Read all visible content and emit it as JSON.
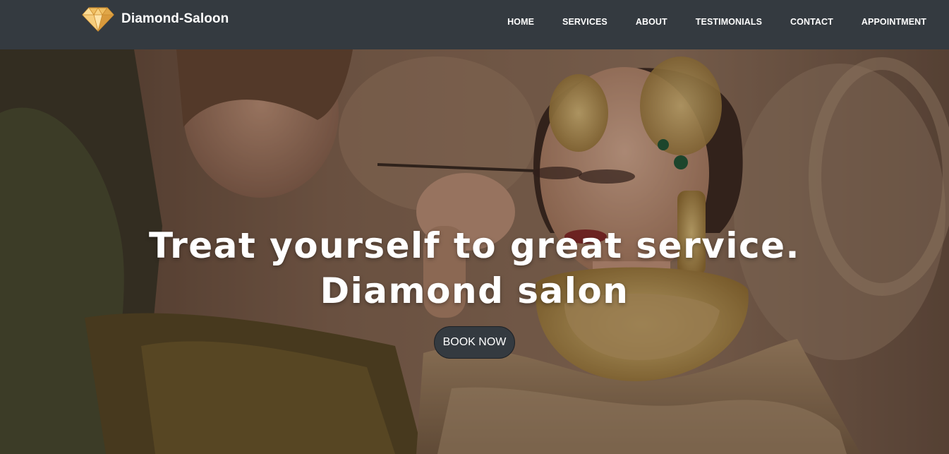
{
  "navbar": {
    "brand_name": "Diamond-Saloon",
    "brand_icon": "diamond-icon",
    "links": [
      {
        "label": "HOME"
      },
      {
        "label": "SERVICES"
      },
      {
        "label": "ABOUT"
      },
      {
        "label": "TESTIMONIALS"
      },
      {
        "label": "CONTACT"
      },
      {
        "label": "APPOINTMENT"
      }
    ]
  },
  "hero": {
    "heading_line1": "Treat yourself to great service.",
    "heading_line2": "Diamond salon",
    "button_label": "BOOK NOW"
  },
  "colors": {
    "navbar_bg": "#343a40",
    "button_bg": "#343a40",
    "text": "#ffffff",
    "logo_gold": "#f2c46d"
  }
}
